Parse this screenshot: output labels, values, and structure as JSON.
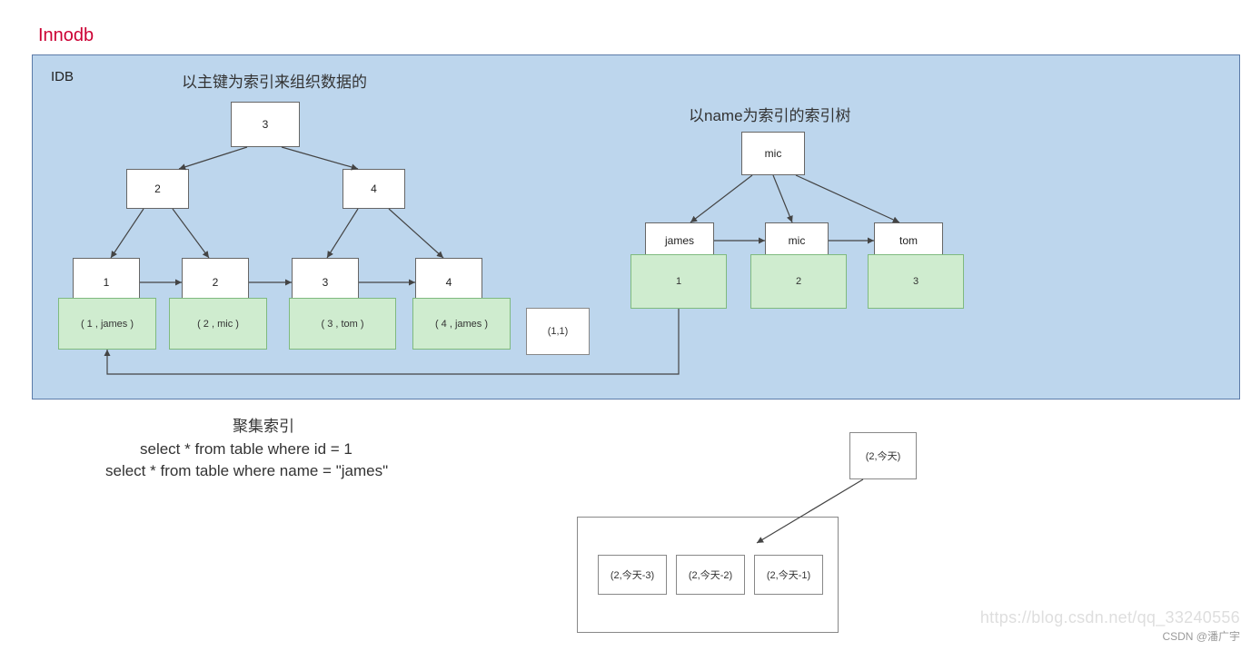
{
  "title": "Innodb",
  "idb_label": "IDB",
  "primary_tree": {
    "heading": "以主键为索引来组织数据的",
    "root": "3",
    "level2": [
      "2",
      "4"
    ],
    "leaves": [
      {
        "key": "1",
        "data": "( 1 , james )"
      },
      {
        "key": "2",
        "data": "( 2 , mic )"
      },
      {
        "key": "3",
        "data": "( 3 , tom )"
      },
      {
        "key": "4",
        "data": "( 4 , james )"
      }
    ],
    "extra": "(1,1)"
  },
  "name_tree": {
    "heading": "以name为索引的索引树",
    "root": "mic",
    "leaves": [
      {
        "key": "james",
        "data": "1"
      },
      {
        "key": "mic",
        "data": "2"
      },
      {
        "key": "tom",
        "data": "3"
      }
    ]
  },
  "footer": {
    "heading": "聚集索引",
    "sql1": "select * from table where id = 1",
    "sql2": "select * from table where name = \"james\""
  },
  "bottom_box": {
    "parent": "(2,今天)",
    "children": [
      "(2,今天-3)",
      "(2,今天-2)",
      "(2,今天-1)"
    ]
  },
  "watermark": {
    "url": "https://blog.csdn.net/qq_33240556",
    "author": "CSDN @潘广宇"
  }
}
